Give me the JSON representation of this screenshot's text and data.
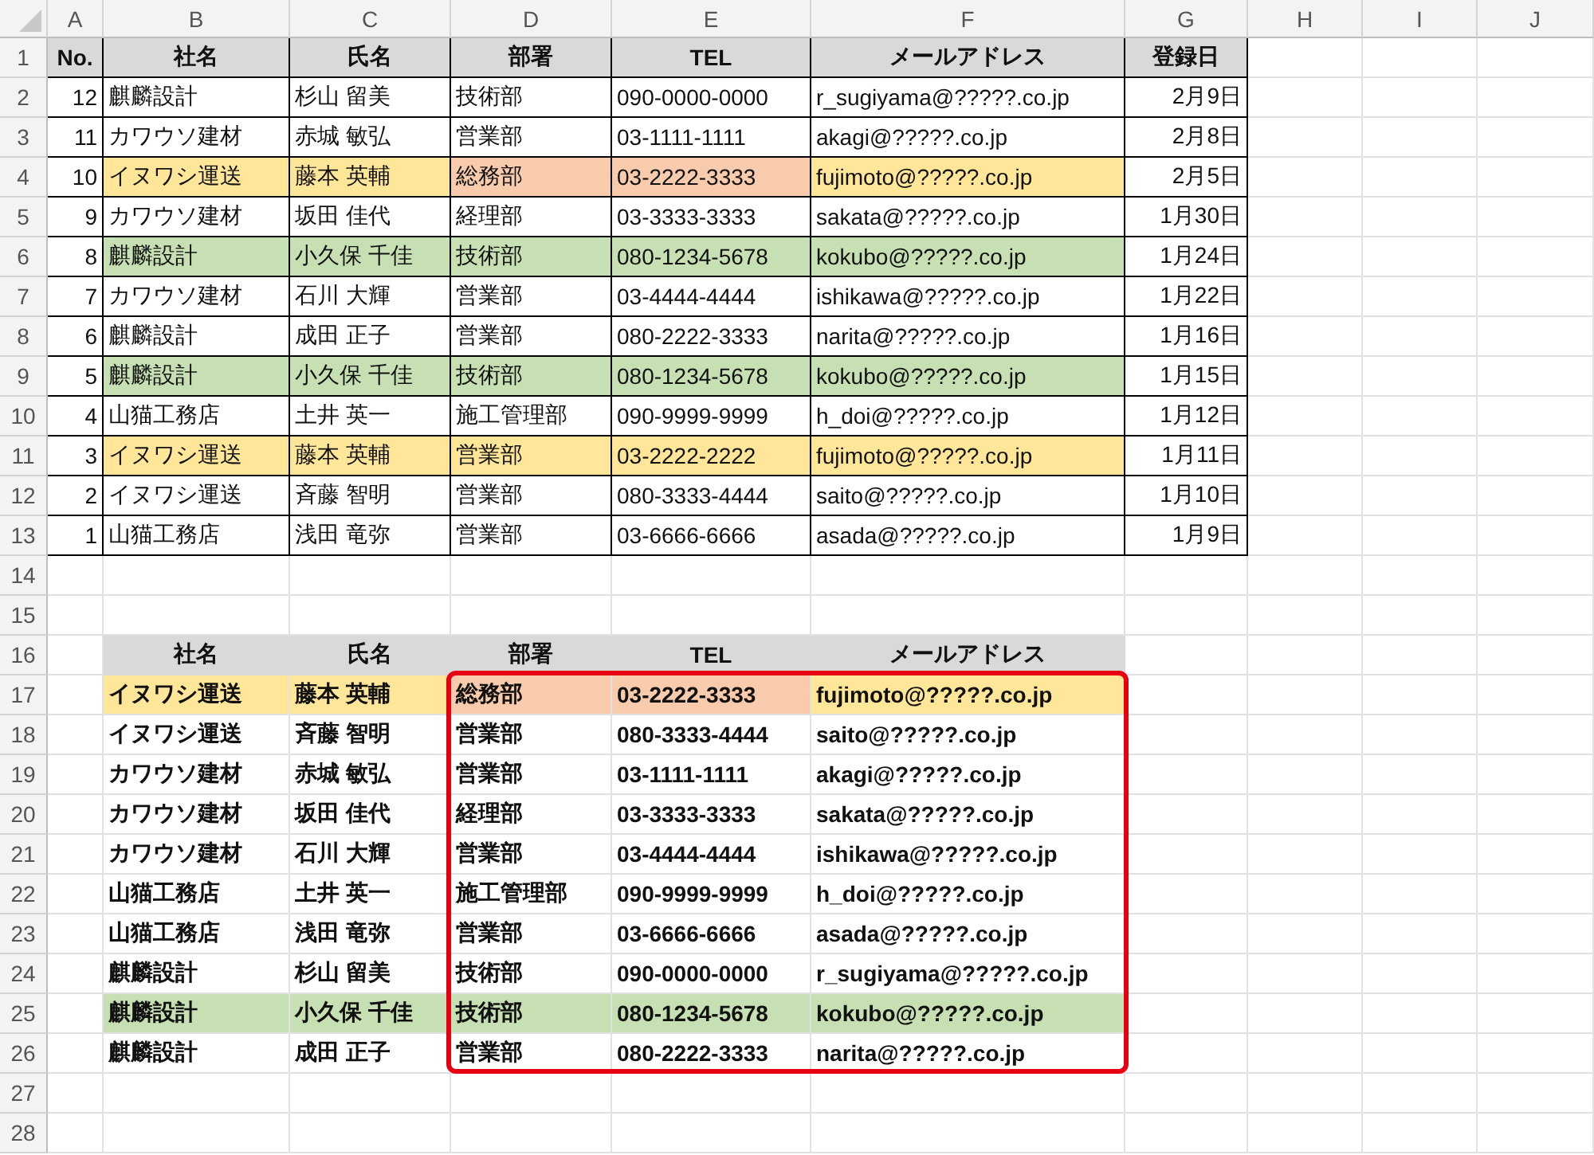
{
  "columns": [
    "A",
    "B",
    "C",
    "D",
    "E",
    "F",
    "G",
    "H",
    "I",
    "J"
  ],
  "row_numbers": [
    "1",
    "2",
    "3",
    "4",
    "5",
    "6",
    "7",
    "8",
    "9",
    "10",
    "11",
    "12",
    "13",
    "14",
    "15",
    "16",
    "17",
    "18",
    "19",
    "20",
    "21",
    "22",
    "23",
    "24",
    "25",
    "26",
    "27",
    "28"
  ],
  "table_top": {
    "headers": [
      "No.",
      "社名",
      "氏名",
      "部署",
      "TEL",
      "メールアドレス",
      "登録日"
    ],
    "rows": [
      {
        "cells": [
          {
            "text": "12"
          },
          {
            "text": "麒麟設計"
          },
          {
            "text": "杉山 留美"
          },
          {
            "text": "技術部"
          },
          {
            "text": "090-0000-0000"
          },
          {
            "text": "r_sugiyama@?????.co.jp"
          },
          {
            "text": "2月9日"
          }
        ]
      },
      {
        "cells": [
          {
            "text": "11"
          },
          {
            "text": "カワウソ建材"
          },
          {
            "text": "赤城 敏弘"
          },
          {
            "text": "営業部"
          },
          {
            "text": "03-1111-1111"
          },
          {
            "text": "akagi@?????.co.jp"
          },
          {
            "text": "2月8日"
          }
        ]
      },
      {
        "cells": [
          {
            "text": "10"
          },
          {
            "text": "イヌワシ運送",
            "color": "#ffe699"
          },
          {
            "text": "藤本 英輔",
            "color": "#ffe699"
          },
          {
            "text": "総務部",
            "color": "#f8cbad"
          },
          {
            "text": "03-2222-3333",
            "color": "#f8cbad"
          },
          {
            "text": "fujimoto@?????.co.jp",
            "color": "#ffe699"
          },
          {
            "text": "2月5日"
          }
        ]
      },
      {
        "cells": [
          {
            "text": "9"
          },
          {
            "text": "カワウソ建材"
          },
          {
            "text": "坂田 佳代"
          },
          {
            "text": "経理部"
          },
          {
            "text": "03-3333-3333"
          },
          {
            "text": "sakata@?????.co.jp"
          },
          {
            "text": "1月30日"
          }
        ]
      },
      {
        "cells": [
          {
            "text": "8"
          },
          {
            "text": "麒麟設計",
            "color": "#c6e0b4"
          },
          {
            "text": "小久保 千佳",
            "color": "#c6e0b4"
          },
          {
            "text": "技術部",
            "color": "#c6e0b4"
          },
          {
            "text": "080-1234-5678",
            "color": "#c6e0b4"
          },
          {
            "text": "kokubo@?????.co.jp",
            "color": "#c6e0b4"
          },
          {
            "text": "1月24日"
          }
        ]
      },
      {
        "cells": [
          {
            "text": "7"
          },
          {
            "text": "カワウソ建材"
          },
          {
            "text": "石川 大輝"
          },
          {
            "text": "営業部"
          },
          {
            "text": "03-4444-4444"
          },
          {
            "text": "ishikawa@?????.co.jp"
          },
          {
            "text": "1月22日"
          }
        ]
      },
      {
        "cells": [
          {
            "text": "6"
          },
          {
            "text": "麒麟設計"
          },
          {
            "text": "成田 正子"
          },
          {
            "text": "営業部"
          },
          {
            "text": "080-2222-3333"
          },
          {
            "text": "narita@?????.co.jp"
          },
          {
            "text": "1月16日"
          }
        ]
      },
      {
        "cells": [
          {
            "text": "5"
          },
          {
            "text": "麒麟設計",
            "color": "#c6e0b4"
          },
          {
            "text": "小久保 千佳",
            "color": "#c6e0b4"
          },
          {
            "text": "技術部",
            "color": "#c6e0b4"
          },
          {
            "text": "080-1234-5678",
            "color": "#c6e0b4"
          },
          {
            "text": "kokubo@?????.co.jp",
            "color": "#c6e0b4"
          },
          {
            "text": "1月15日"
          }
        ]
      },
      {
        "cells": [
          {
            "text": "4"
          },
          {
            "text": "山猫工務店"
          },
          {
            "text": "土井 英一"
          },
          {
            "text": "施工管理部"
          },
          {
            "text": "090-9999-9999"
          },
          {
            "text": "h_doi@?????.co.jp"
          },
          {
            "text": "1月12日"
          }
        ]
      },
      {
        "cells": [
          {
            "text": "3"
          },
          {
            "text": "イヌワシ運送",
            "color": "#ffe699"
          },
          {
            "text": "藤本 英輔",
            "color": "#ffe699"
          },
          {
            "text": "営業部",
            "color": "#ffe699"
          },
          {
            "text": "03-2222-2222",
            "color": "#ffe699"
          },
          {
            "text": "fujimoto@?????.co.jp",
            "color": "#ffe699"
          },
          {
            "text": "1月11日"
          }
        ]
      },
      {
        "cells": [
          {
            "text": "2"
          },
          {
            "text": "イヌワシ運送"
          },
          {
            "text": "斉藤 智明"
          },
          {
            "text": "営業部"
          },
          {
            "text": "080-3333-4444"
          },
          {
            "text": "saito@?????.co.jp"
          },
          {
            "text": "1月10日"
          }
        ]
      },
      {
        "cells": [
          {
            "text": "1"
          },
          {
            "text": "山猫工務店"
          },
          {
            "text": "浅田 竜弥"
          },
          {
            "text": "営業部"
          },
          {
            "text": "03-6666-6666"
          },
          {
            "text": "asada@?????.co.jp"
          },
          {
            "text": "1月9日"
          }
        ]
      }
    ]
  },
  "table_sorted": {
    "headers": [
      "社名",
      "氏名",
      "部署",
      "TEL",
      "メールアドレス"
    ],
    "rows": [
      {
        "cells": [
          {
            "text": "イヌワシ運送",
            "color": "#ffe699"
          },
          {
            "text": "藤本 英輔",
            "color": "#ffe699"
          },
          {
            "text": "総務部",
            "color": "#f8cbad"
          },
          {
            "text": "03-2222-3333",
            "color": "#f8cbad"
          },
          {
            "text": "fujimoto@?????.co.jp",
            "color": "#ffe699"
          }
        ]
      },
      {
        "cells": [
          {
            "text": "イヌワシ運送"
          },
          {
            "text": "斉藤 智明"
          },
          {
            "text": "営業部"
          },
          {
            "text": "080-3333-4444"
          },
          {
            "text": "saito@?????.co.jp"
          }
        ]
      },
      {
        "cells": [
          {
            "text": "カワウソ建材"
          },
          {
            "text": "赤城 敏弘"
          },
          {
            "text": "営業部"
          },
          {
            "text": "03-1111-1111"
          },
          {
            "text": "akagi@?????.co.jp"
          }
        ]
      },
      {
        "cells": [
          {
            "text": "カワウソ建材"
          },
          {
            "text": "坂田 佳代"
          },
          {
            "text": "経理部"
          },
          {
            "text": "03-3333-3333"
          },
          {
            "text": "sakata@?????.co.jp"
          }
        ]
      },
      {
        "cells": [
          {
            "text": "カワウソ建材"
          },
          {
            "text": "石川 大輝"
          },
          {
            "text": "営業部"
          },
          {
            "text": "03-4444-4444"
          },
          {
            "text": "ishikawa@?????.co.jp"
          }
        ]
      },
      {
        "cells": [
          {
            "text": "山猫工務店"
          },
          {
            "text": "土井 英一"
          },
          {
            "text": "施工管理部"
          },
          {
            "text": "090-9999-9999"
          },
          {
            "text": "h_doi@?????.co.jp"
          }
        ]
      },
      {
        "cells": [
          {
            "text": "山猫工務店"
          },
          {
            "text": "浅田 竜弥"
          },
          {
            "text": "営業部"
          },
          {
            "text": "03-6666-6666"
          },
          {
            "text": "asada@?????.co.jp"
          }
        ]
      },
      {
        "cells": [
          {
            "text": "麒麟設計"
          },
          {
            "text": "杉山 留美"
          },
          {
            "text": "技術部"
          },
          {
            "text": "090-0000-0000"
          },
          {
            "text": "r_sugiyama@?????.co.jp"
          }
        ]
      },
      {
        "cells": [
          {
            "text": "麒麟設計",
            "color": "#c6e0b4"
          },
          {
            "text": "小久保 千佳",
            "color": "#c6e0b4"
          },
          {
            "text": "技術部",
            "color": "#c6e0b4"
          },
          {
            "text": "080-1234-5678",
            "color": "#c6e0b4"
          },
          {
            "text": "kokubo@?????.co.jp",
            "color": "#c6e0b4"
          }
        ]
      },
      {
        "cells": [
          {
            "text": "麒麟設計"
          },
          {
            "text": "成田 正子"
          },
          {
            "text": "営業部"
          },
          {
            "text": "080-2222-3333"
          },
          {
            "text": "narita@?????.co.jp"
          }
        ]
      }
    ]
  }
}
